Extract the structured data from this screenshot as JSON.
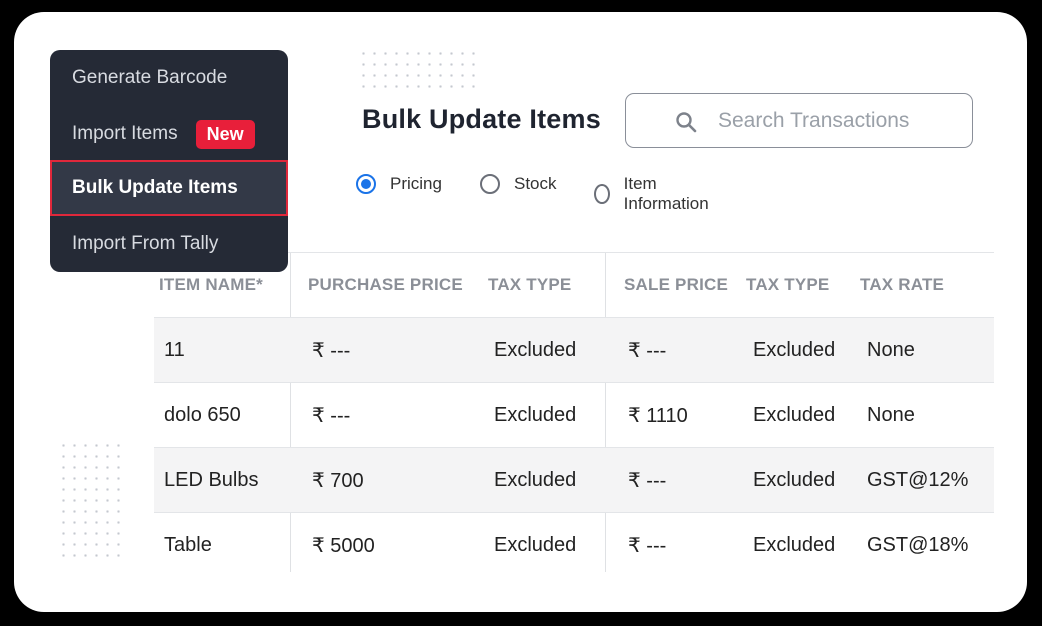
{
  "page_title": "Bulk Update Items",
  "search": {
    "placeholder": "Search Transactions",
    "icon": "search-icon"
  },
  "radio_options": [
    {
      "label": "Pricing",
      "checked": true
    },
    {
      "label": "Stock",
      "checked": false
    },
    {
      "label": "Item Information",
      "checked": false
    }
  ],
  "menu": {
    "items": [
      {
        "label": "Generate Barcode"
      },
      {
        "label": "Import Items",
        "badge": "New"
      },
      {
        "label": "Bulk Update Items",
        "active": true
      },
      {
        "label": "Import From Tally"
      }
    ]
  },
  "table": {
    "headers": [
      "ITEM NAME*",
      "PURCHASE PRICE",
      "TAX TYPE",
      "SALE PRICE",
      "TAX TYPE",
      "TAX RATE"
    ],
    "rows": [
      [
        "11",
        "₹ ---",
        "Excluded",
        "₹ ---",
        "Excluded",
        "None"
      ],
      [
        "dolo 650",
        "₹ ---",
        "Excluded",
        "₹ 1110",
        "Excluded",
        "None"
      ],
      [
        "LED Bulbs",
        "₹ 700",
        "Excluded",
        "₹ ---",
        "Excluded",
        "GST@12%"
      ],
      [
        "Table",
        "₹ 5000",
        "Excluded",
        "₹ ---",
        "Excluded",
        "GST@18%"
      ]
    ]
  },
  "colors": {
    "accent": "#1a73e8",
    "badge": "#e81f3a",
    "menu_bg": "#252a36",
    "active_border": "#e0283b"
  }
}
